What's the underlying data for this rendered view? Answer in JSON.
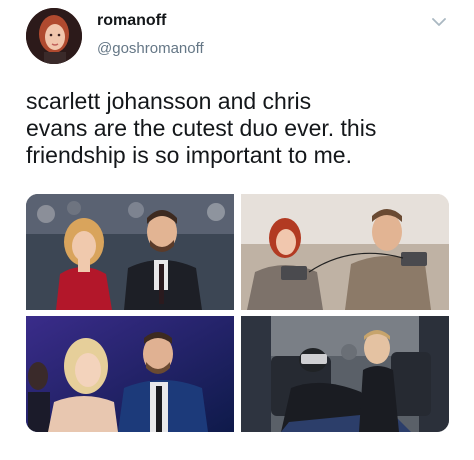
{
  "user": {
    "display_name": "romanoff",
    "handle": "@goshromanoff",
    "avatar_icon": "profile-avatar"
  },
  "tweet": {
    "text": "scarlett johansson and chris\nevans are the cutest duo ever. this\nfriendship is so important to me."
  },
  "menu": {
    "icon": "chevron-down-icon"
  },
  "media": {
    "photos": [
      {
        "name": "red-carpet-photo"
      },
      {
        "name": "gaming-on-couch-photo"
      },
      {
        "name": "event-selfie-photo"
      },
      {
        "name": "airplane-photo"
      }
    ]
  },
  "colors": {
    "text": "#14171a",
    "secondary": "#657786",
    "chevron": "#aab8c2"
  }
}
